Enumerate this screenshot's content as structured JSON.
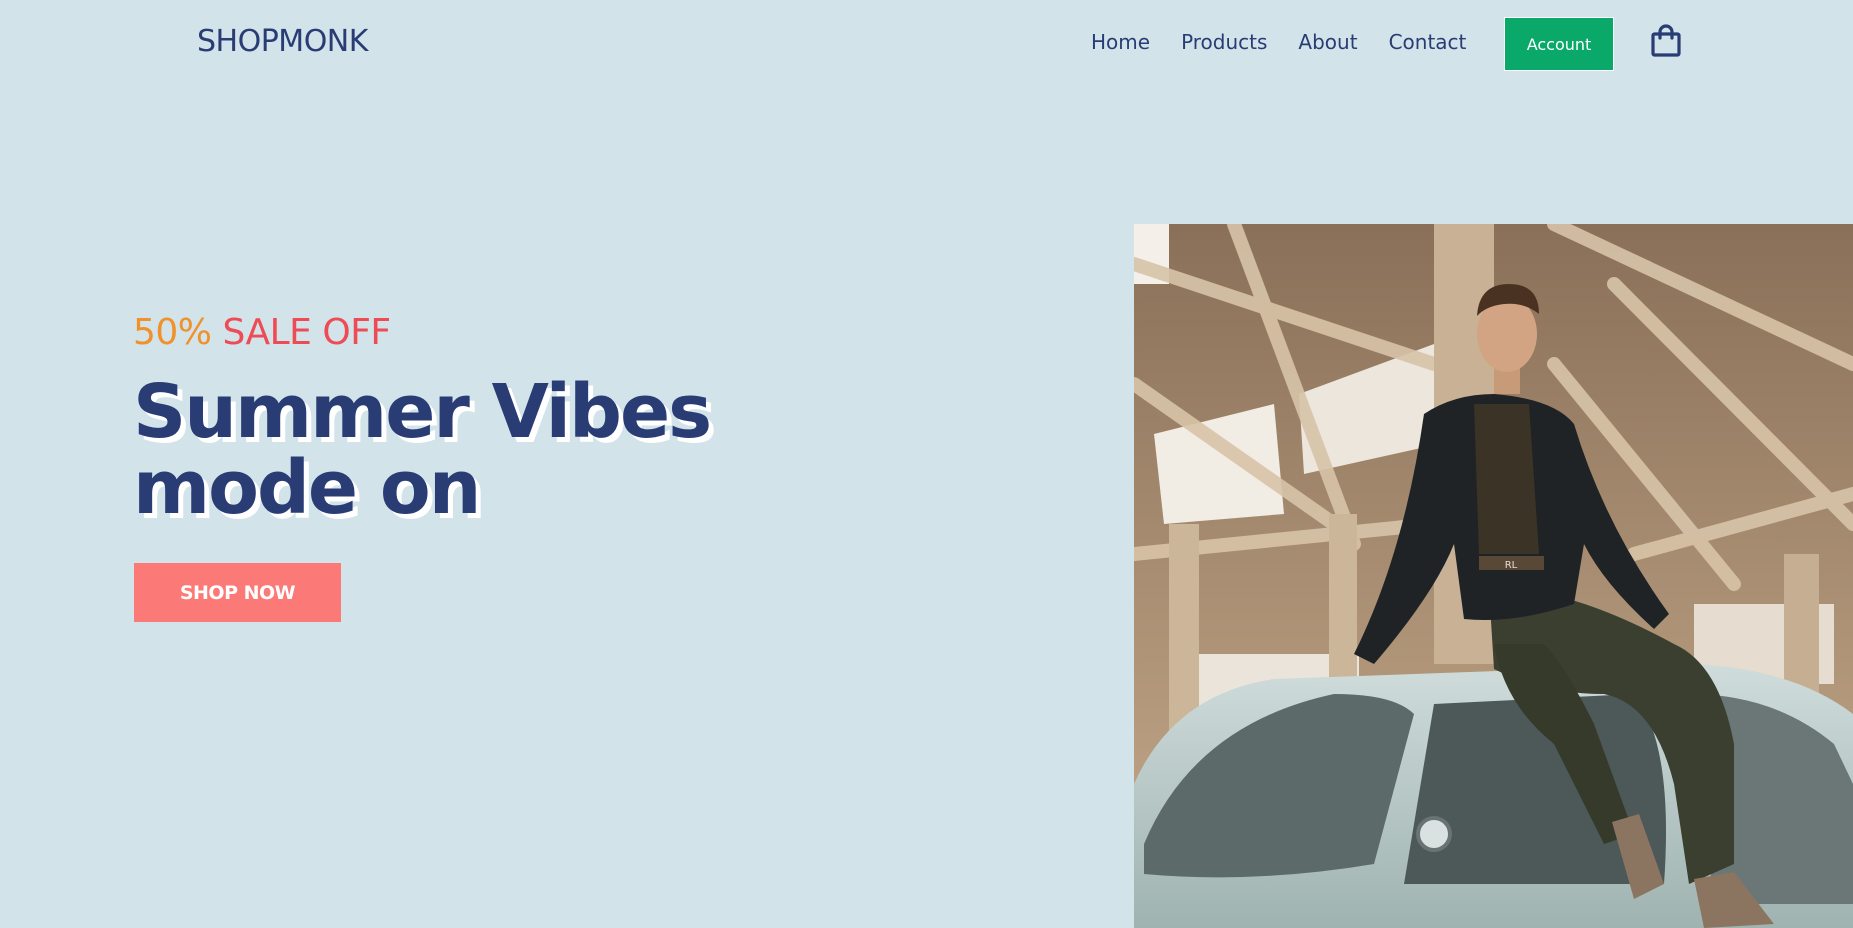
{
  "header": {
    "logo": "SHOPMONK",
    "nav": [
      "Home",
      "Products",
      "About",
      "Contact"
    ],
    "account_label": "Account",
    "cart_icon": "shopping-bag-icon"
  },
  "hero": {
    "promo_percent": "50%",
    "promo_text": "SALE OFF",
    "headline_line1": "Summer Vibes",
    "headline_line2": "mode on",
    "cta_label": "SHOP NOW",
    "image_label": "RL"
  },
  "colors": {
    "background": "#d2e3ea",
    "brand_navy": "#2a3c74",
    "account_green": "#0aa96a",
    "cta_coral": "#fb7a78",
    "promo_orange": "#f0922c",
    "promo_red": "#ee4b55"
  }
}
